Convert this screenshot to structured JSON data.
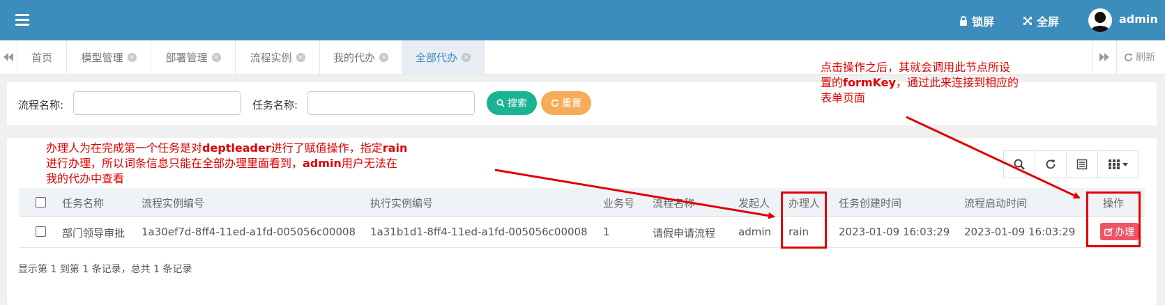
{
  "header": {
    "lock_label": "锁屏",
    "fullscreen_label": "全屏",
    "user_name": "admin",
    "bg_color": "#3c8dbc"
  },
  "tabs": [
    {
      "label": "首页",
      "closable": false
    },
    {
      "label": "模型管理",
      "closable": true
    },
    {
      "label": "部署管理",
      "closable": true
    },
    {
      "label": "流程实例",
      "closable": true
    },
    {
      "label": "我的代办",
      "closable": true
    },
    {
      "label": "全部代办",
      "closable": true,
      "active": true
    }
  ],
  "tabs_refresh_label": "刷新",
  "search": {
    "process_name_label": "流程名称:",
    "task_name_label": "任务名称:",
    "search_button": "搜索",
    "reset_button": "重置"
  },
  "table": {
    "columns": [
      "任务名称",
      "流程实例编号",
      "执行实例编号",
      "业务号",
      "流程名称",
      "发起人",
      "办理人",
      "任务创建时间",
      "流程启动时间",
      "操作"
    ],
    "rows": [
      {
        "task_name": "部门领导审批",
        "process_instance_id": "1a30ef7d-8ff4-11ed-a1fd-005056c00008",
        "execution_id": "1a31b1d1-8ff4-11ed-a1fd-005056c00008",
        "business_key": "1",
        "process_name": "请假申请流程",
        "initiator": "admin",
        "assignee": "rain",
        "task_create_time": "2023-01-09 16:03:29",
        "process_start_time": "2023-01-09 16:03:29",
        "action_label": "办理"
      }
    ],
    "pager_text": "显示第 1 到第 1 条记录，总共 1 条记录"
  },
  "annotations": {
    "left": {
      "line1_a": "办理人为在完成第一个任务是对",
      "line1_b": "deptleader",
      "line1_c": "进行了赋值操作，指定",
      "line1_d": "rain",
      "line2_a": "进行办理，所以词条信息只能在全部办理里面看到，",
      "line2_b": "admin",
      "line2_c": "用户无法在",
      "line3": "我的代办中查看"
    },
    "right": {
      "line1": "点击操作之后，其就会调用此节点所设",
      "line2_a": "置的",
      "line2_b": "formKey",
      "line2_c": "，通过此来连接到相应的",
      "line3": "表单页面"
    },
    "color": "#e00000"
  }
}
